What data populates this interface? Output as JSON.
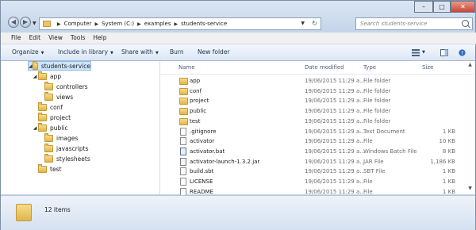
{
  "address": {
    "crumbs": [
      "Computer",
      "System (C:)",
      "examples",
      "students-service"
    ]
  },
  "search": {
    "placeholder": "Search students-service"
  },
  "window_controls": {
    "minimize": "–",
    "maximize": "□",
    "close": "✕"
  },
  "menu": [
    "File",
    "Edit",
    "View",
    "Tools",
    "Help"
  ],
  "commands": {
    "organize": "Organize",
    "include": "Include in library",
    "share": "Share with",
    "burn": "Burn",
    "new_folder": "New folder"
  },
  "tree": [
    {
      "label": "students-service",
      "expanded": true,
      "selected": true
    },
    {
      "label": "app",
      "expanded": true
    },
    {
      "label": "controllers"
    },
    {
      "label": "views"
    },
    {
      "label": "conf"
    },
    {
      "label": "project"
    },
    {
      "label": "public",
      "expanded": true
    },
    {
      "label": "images"
    },
    {
      "label": "javascripts"
    },
    {
      "label": "stylesheets"
    },
    {
      "label": "test"
    }
  ],
  "columns": {
    "name": "Name",
    "date": "Date modified",
    "type": "Type",
    "size": "Size"
  },
  "files": [
    {
      "name": "app",
      "date": "19/06/2015 11:29 a...",
      "type": "File folder",
      "size": "",
      "icon": "folder"
    },
    {
      "name": "conf",
      "date": "19/06/2015 11:29 a...",
      "type": "File folder",
      "size": "",
      "icon": "folder"
    },
    {
      "name": "project",
      "date": "19/06/2015 11:29 a...",
      "type": "File folder",
      "size": "",
      "icon": "folder"
    },
    {
      "name": "public",
      "date": "19/06/2015 11:29 a...",
      "type": "File folder",
      "size": "",
      "icon": "folder"
    },
    {
      "name": "test",
      "date": "19/06/2015 11:29 a...",
      "type": "File folder",
      "size": "",
      "icon": "folder"
    },
    {
      "name": ".gitignore",
      "date": "19/06/2015 11:29 a...",
      "type": "Text Document",
      "size": "1 KB",
      "icon": "file"
    },
    {
      "name": "activator",
      "date": "19/06/2015 11:29 a...",
      "type": "File",
      "size": "10 KB",
      "icon": "file"
    },
    {
      "name": "activator.bat",
      "date": "19/06/2015 11:29 a...",
      "type": "Windows Batch File",
      "size": "8 KB",
      "icon": "bat"
    },
    {
      "name": "activator-launch-1.3.2.jar",
      "date": "19/06/2015 11:29 a...",
      "type": "JAR File",
      "size": "1,186 KB",
      "icon": "jar"
    },
    {
      "name": "build.sbt",
      "date": "19/06/2015 11:29 a...",
      "type": "SBT File",
      "size": "1 KB",
      "icon": "file"
    },
    {
      "name": "LICENSE",
      "date": "19/06/2015 11:29 a...",
      "type": "File",
      "size": "1 KB",
      "icon": "file"
    },
    {
      "name": "README",
      "date": "19/06/2015 11:29 a...",
      "type": "File",
      "size": "1 KB",
      "icon": "file"
    }
  ],
  "status": {
    "items": "12 items"
  }
}
